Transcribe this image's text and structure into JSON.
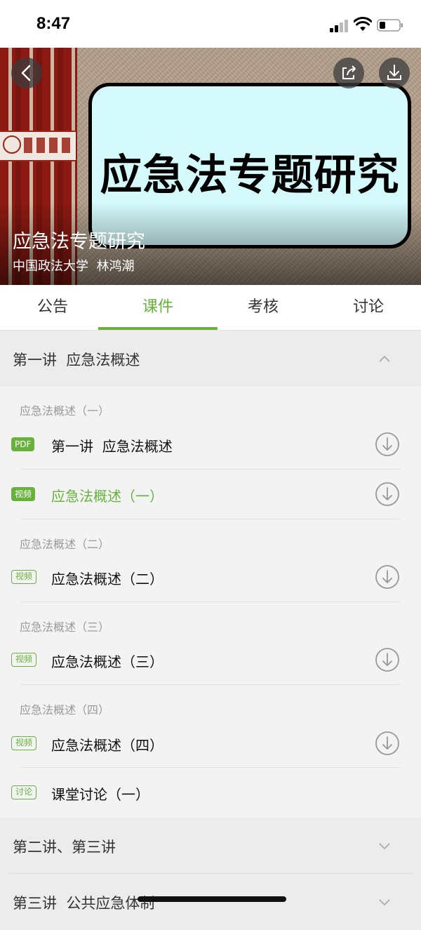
{
  "status_bar": {
    "time": "8:47"
  },
  "banner": {
    "poster_title": "应急法专题研究",
    "course_title": "应急法专题研究",
    "subtitle": "中国政法大学  林鸿潮"
  },
  "tabs": [
    {
      "label": "公告"
    },
    {
      "label": "课件"
    },
    {
      "label": "考核"
    },
    {
      "label": "讨论"
    }
  ],
  "active_tab": "课件",
  "sections": [
    {
      "title": "第一讲  应急法概述",
      "expanded": true,
      "groups": [
        {
          "label": "应急法概述（一）",
          "items": [
            {
              "badge": "PDF",
              "title": "第一讲  应急法概述",
              "downloadable": true
            },
            {
              "badge": "视频",
              "title": "应急法概述（一）",
              "downloadable": true,
              "active": true
            }
          ]
        },
        {
          "label": "应急法概述（二）",
          "items": [
            {
              "badge": "视频",
              "title": "应急法概述（二）",
              "downloadable": true
            }
          ]
        },
        {
          "label": "应急法概述（三）",
          "items": [
            {
              "badge": "视频",
              "title": "应急法概述（三）",
              "downloadable": true
            }
          ]
        },
        {
          "label": "应急法概述（四）",
          "items": [
            {
              "badge": "视频",
              "title": "应急法概述（四）",
              "downloadable": true
            },
            {
              "badge": "讨论",
              "title": "课堂讨论（一）",
              "downloadable": false
            }
          ]
        }
      ]
    },
    {
      "title": "第二讲、第三讲",
      "expanded": false
    },
    {
      "title": "第三讲  公共应急体制",
      "expanded": false
    }
  ],
  "colors": {
    "accent": "#67b13c",
    "section_bg": "#ececec",
    "list_bg": "#f3f3f3"
  },
  "icons": [
    "back-icon",
    "share-icon",
    "download-icon",
    "chevron-up-icon",
    "chevron-down-icon",
    "download-circle-icon"
  ]
}
